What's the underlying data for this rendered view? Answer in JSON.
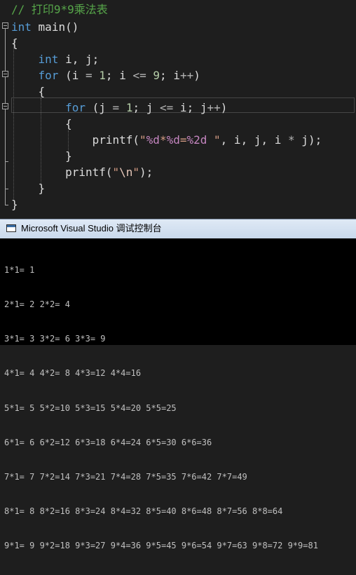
{
  "editor": {
    "comment": "// 打印9*9乘法表",
    "kw_int": "int",
    "main_name": "main",
    "kw_for": "for",
    "printf": "printf",
    "fmt_string_parts": [
      "\"",
      "%d",
      "*",
      "%d",
      "=",
      "%2d",
      " \""
    ],
    "newline_string_parts": [
      "\"",
      "\\n",
      "\""
    ],
    "i": "i",
    "j": "j",
    "num_1": "1",
    "num_9": "9"
  },
  "console": {
    "title": "Microsoft Visual Studio 调试控制台",
    "output_lines": [
      "1*1= 1",
      "2*1= 2 2*2= 4",
      "3*1= 3 3*2= 6 3*3= 9",
      "4*1= 4 4*2= 8 4*3=12 4*4=16",
      "5*1= 5 5*2=10 5*3=15 5*4=20 5*5=25",
      "6*1= 6 6*2=12 6*3=18 6*4=24 6*5=30 6*6=36",
      "7*1= 7 7*2=14 7*3=21 7*4=28 7*5=35 7*6=42 7*7=49",
      "8*1= 8 8*2=16 8*3=24 8*4=32 8*5=40 8*6=48 8*7=56 8*8=64",
      "9*1= 9 9*2=18 9*3=27 9*4=36 9*5=45 9*6=54 9*7=63 9*8=72 9*9=81"
    ]
  },
  "colors": {
    "keyword": "#569cd6",
    "comment": "#57a64a",
    "string": "#d69d85",
    "background": "#1e1e1e"
  }
}
